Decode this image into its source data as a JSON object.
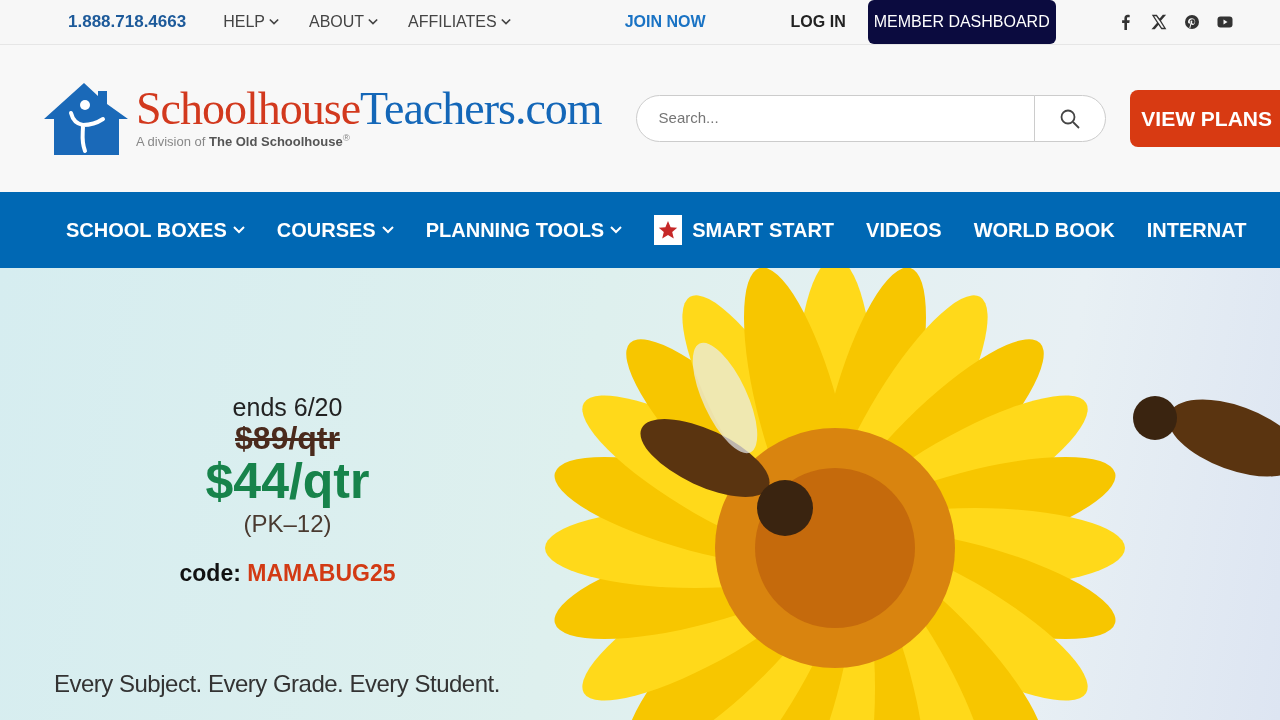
{
  "top_bar": {
    "phone": "1.888.718.4663",
    "links": [
      {
        "label": "HELP",
        "has_dropdown": true
      },
      {
        "label": "ABOUT",
        "has_dropdown": true
      },
      {
        "label": "AFFILIATES",
        "has_dropdown": true
      }
    ],
    "join": "JOIN NOW",
    "login": "LOG IN",
    "dashboard": "MEMBER DASHBOARD",
    "social": [
      {
        "kind": "facebook"
      },
      {
        "kind": "x"
      },
      {
        "kind": "pinterest"
      },
      {
        "kind": "youtube"
      }
    ]
  },
  "header": {
    "logo_left": "Schoolhouse",
    "logo_right": "Teachers.com",
    "logo_tagline": "A division of **The Old Schoolhouse**$^{®}$",
    "search": {
      "placeholder": "Search..."
    },
    "cta": "VIEW PLANS"
  },
  "nav": [
    {
      "label": "SCHOOL BOXES",
      "has_dropdown": true,
      "kind": "text"
    },
    {
      "label": "COURSES",
      "has_dropdown": true,
      "kind": "text"
    },
    {
      "label": "PLANNING TOOLS",
      "has_dropdown": true,
      "kind": "text"
    },
    {
      "label": "SMART START",
      "has_dropdown": false,
      "kind": "star"
    },
    {
      "label": "VIDEOS",
      "has_dropdown": false,
      "kind": "text"
    },
    {
      "label": "WORLD BOOK",
      "has_dropdown": false,
      "kind": "text"
    },
    {
      "label": "INTERNAT",
      "has_dropdown": false,
      "kind": "text"
    }
  ],
  "hero": {
    "ends": "ends 6/20",
    "old_price": "$89/qtr",
    "price": "$44/qtr",
    "grades": "(PK–12)",
    "code_label": "code:",
    "code": "MAMABUG25",
    "tagline": "Every Subject. Every Grade. Every Student."
  }
}
